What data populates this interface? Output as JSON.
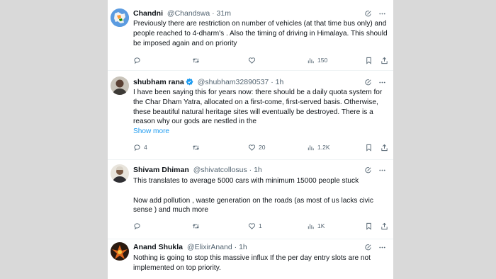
{
  "posts": [
    {
      "name": "Chandni",
      "handle": "@Chandswa",
      "sep": "·",
      "time": "31m",
      "verified": false,
      "paragraphs": [
        "Previously there are restriction on number of vehicles (at that time bus only) and people reached to 4-dharm's . Also the timing of driving in Himalaya. This should be imposed again and on priority"
      ],
      "show_more": "",
      "counts": {
        "reply": "",
        "repost": "",
        "like": "",
        "views": "150"
      }
    },
    {
      "name": "shubham rana",
      "handle": "@shubham32890537",
      "sep": "·",
      "time": "1h",
      "verified": true,
      "paragraphs": [
        "I have been saying this for years now: there should be a daily quota system for the Char Dham Yatra, allocated on a first-come, first-served basis. Otherwise, these beautiful natural heritage sites will eventually be destroyed. There is a reason why our gods are nestled in the"
      ],
      "show_more": "Show more",
      "counts": {
        "reply": "4",
        "repost": "",
        "like": "20",
        "views": "1.2K"
      }
    },
    {
      "name": "Shivam Dhiman",
      "handle": "@shivatcollosus",
      "sep": "·",
      "time": "1h",
      "verified": false,
      "paragraphs": [
        "This translates to average 5000 cars with minimum 15000 people stuck",
        "Now add pollution , waste generation on the roads (as most of us lacks civic sense ) and much more"
      ],
      "show_more": "",
      "counts": {
        "reply": "",
        "repost": "",
        "like": "1",
        "views": "1K"
      }
    },
    {
      "name": "Anand Shukla",
      "handle": "@ElixirAnand",
      "sep": "·",
      "time": "1h",
      "verified": false,
      "paragraphs": [
        "Nothing is going to stop this massive influx If the per day entry slots are not implemented on top priority."
      ],
      "show_more": "",
      "counts": {
        "reply": "",
        "repost": "",
        "like": "",
        "views": ""
      }
    }
  ],
  "icons": {
    "top": [
      "grok-icon",
      "more-icon"
    ],
    "actions": [
      "reply-icon",
      "repost-icon",
      "like-icon",
      "views-icon",
      "bookmark-icon",
      "share-icon"
    ]
  },
  "colors": {
    "link": "#1d9bf0",
    "secondary": "#536471",
    "text": "#0f1419",
    "verified": "#1d9bf0"
  }
}
